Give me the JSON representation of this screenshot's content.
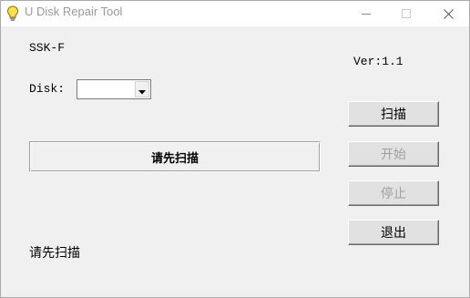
{
  "window": {
    "title": "U Disk Repair Tool",
    "icon": "lightbulb-icon",
    "controls": {
      "minimize_icon": "minimize-icon",
      "maximize_icon": "maximize-icon",
      "close_icon": "close-icon"
    }
  },
  "main": {
    "model": "SSK-F",
    "version": "Ver:1.1",
    "disk_label": "Disk:",
    "disk_select": {
      "value": "",
      "arrow_icon": "dropdown-arrow-icon"
    },
    "status_panel_text": "请先扫描",
    "status_text": "请先扫描"
  },
  "buttons": {
    "scan": {
      "label": "扫描",
      "enabled": true
    },
    "start": {
      "label": "开始",
      "enabled": false
    },
    "stop": {
      "label": "停止",
      "enabled": false
    },
    "exit": {
      "label": "退出",
      "enabled": true
    }
  },
  "colors": {
    "window_bg": "#f0f0f0",
    "titlebar_bg": "#ffffff",
    "title_text": "#999999",
    "disabled_text": "#a0a0a0",
    "button_face": "#e1e1e1"
  }
}
